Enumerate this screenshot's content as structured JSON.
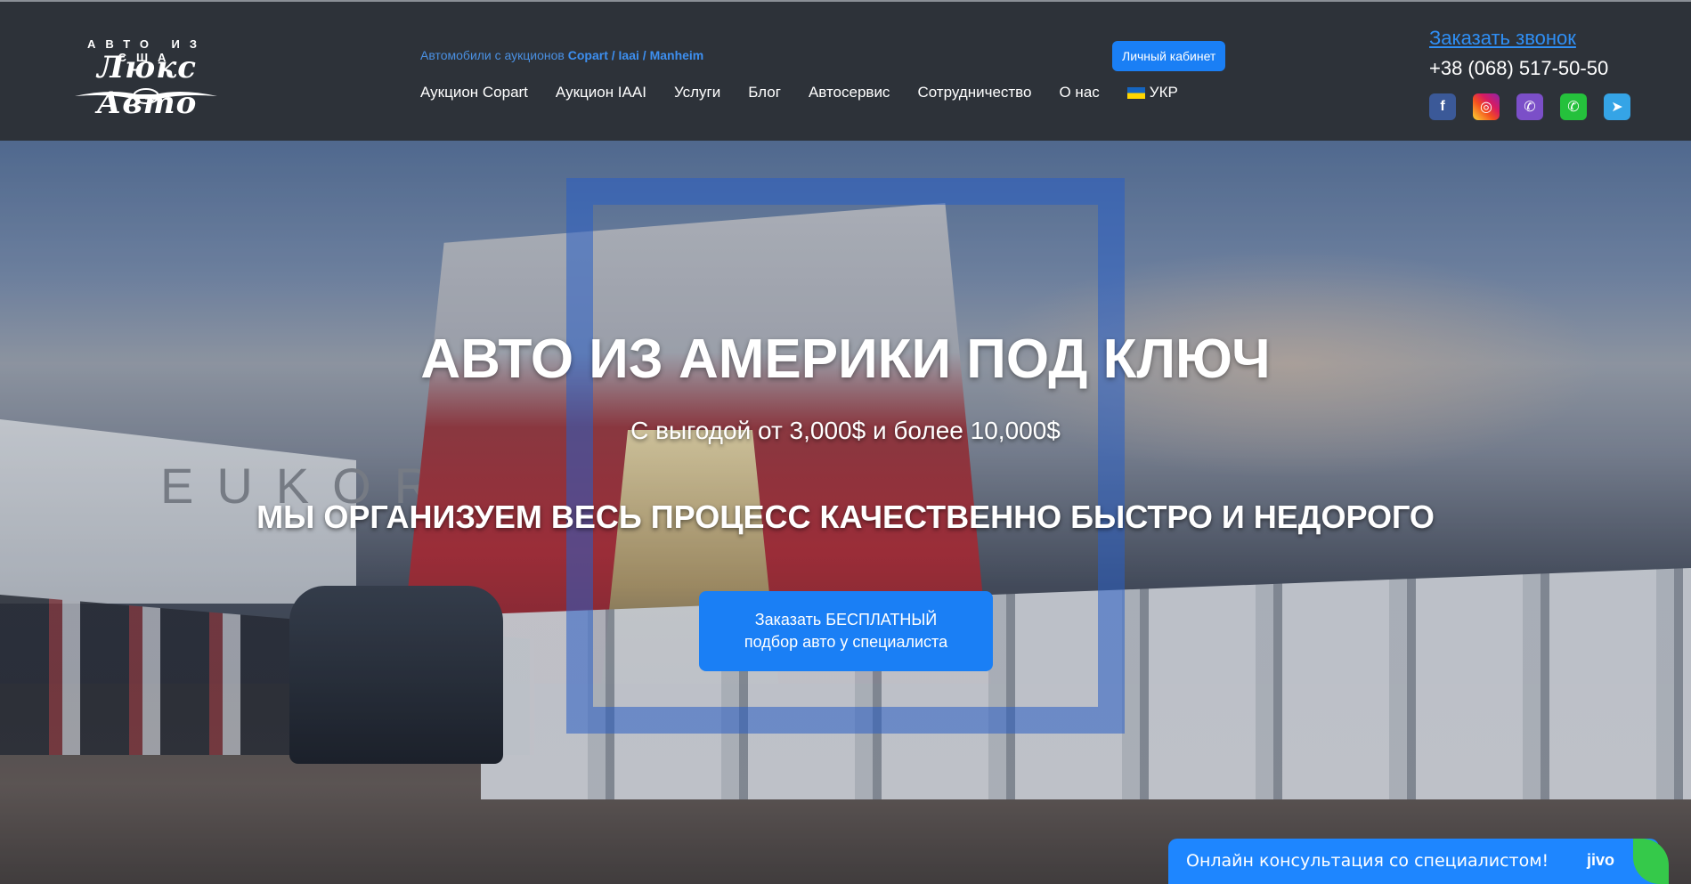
{
  "logo": {
    "top_text": "АВТО ИЗ США",
    "script_text": "Люкс Авто"
  },
  "header": {
    "tagline_prefix": "Автомобили с аукционов",
    "tagline_highlight": "Copart / Iaai / Manheim",
    "cabinet_label": "Личный кабинет",
    "nav": [
      {
        "label": "Аукцион Copart"
      },
      {
        "label": "Аукцион IAAI"
      },
      {
        "label": "Услуги"
      },
      {
        "label": "Блог"
      },
      {
        "label": "Автосервис"
      },
      {
        "label": "Сотрудничество"
      },
      {
        "label": "О нас"
      },
      {
        "label": "УКР"
      }
    ],
    "call_link": "Заказать звонок",
    "phone": "+38 (068) 517-50-50",
    "socials": [
      {
        "icon": "facebook-icon",
        "glyph": "f"
      },
      {
        "icon": "instagram-icon",
        "glyph": "◎"
      },
      {
        "icon": "viber-icon",
        "glyph": "✆"
      },
      {
        "icon": "whatsapp-icon",
        "glyph": "✆"
      },
      {
        "icon": "telegram-icon",
        "glyph": "➤"
      }
    ]
  },
  "hero": {
    "title": "АВТО ИЗ АМЕРИКИ ПОД КЛЮЧ",
    "subtitle": "С выгодой от 3,000$ и более 10,000$",
    "slogan": "МЫ ОРГАНИЗУЕМ ВЕСЬ ПРОЦЕСС КАЧЕСТВЕННО БЫСТРО И НЕДОРОГО",
    "cta_line1": "Заказать БЕСПЛАТНЫЙ",
    "cta_line2": "подбор авто у специалиста",
    "ship_text": "EUKOR"
  },
  "chat": {
    "label": "Онлайн консультация со специалистом!",
    "brand": "jivo"
  },
  "colors": {
    "header_bg": "#2d3239",
    "accent_blue": "#1a7ff5",
    "link_blue": "#2f8ff5"
  }
}
